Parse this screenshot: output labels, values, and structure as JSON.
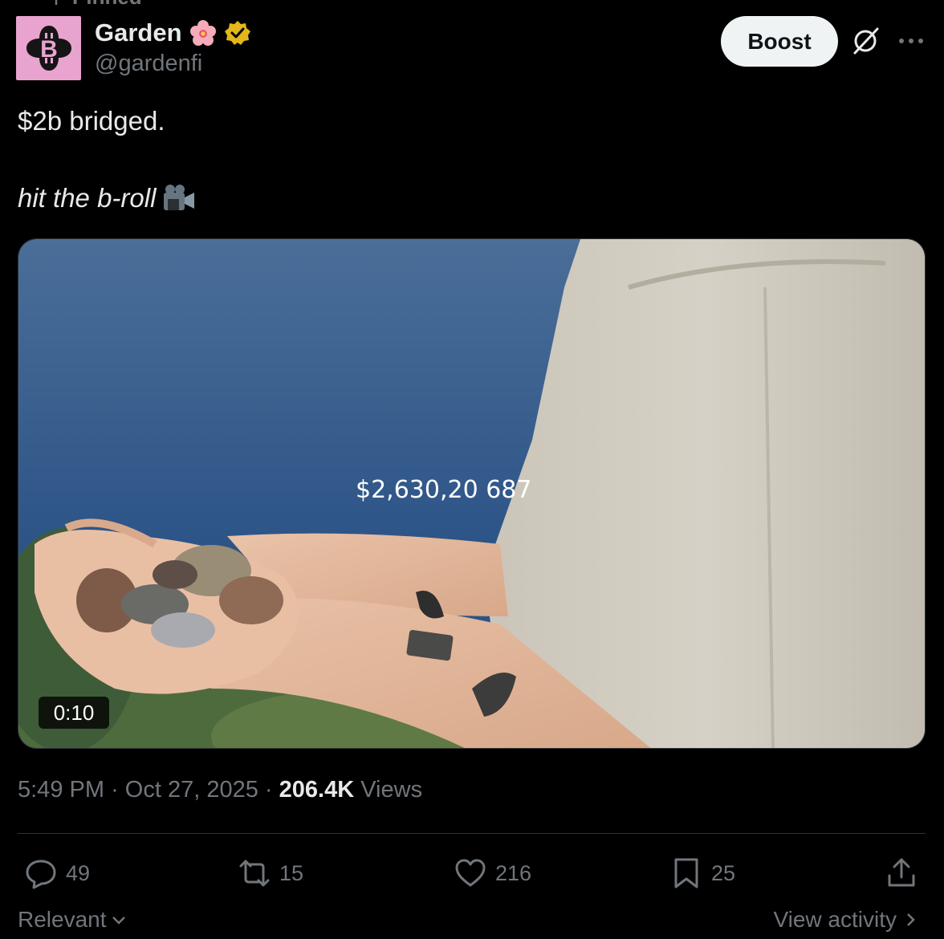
{
  "pinned_label": "Pinned",
  "author": {
    "display_name": "Garden",
    "handle": "@gardenfi"
  },
  "header": {
    "boost_label": "Boost"
  },
  "tweet": {
    "line1": "$2b bridged.",
    "line2": "hit the b-roll"
  },
  "media": {
    "duration": "0:10",
    "overlay_text": "$2,630,20 687"
  },
  "meta": {
    "time": "5:49 PM",
    "separator": "·",
    "date": "Oct 27, 2025",
    "views_count": "206.4K",
    "views_label": "Views"
  },
  "actions": {
    "replies": "49",
    "reposts": "15",
    "likes": "216",
    "bookmarks": "25"
  },
  "footer": {
    "sort_label": "Relevant",
    "activity_label": "View activity"
  },
  "colors": {
    "background": "#000000",
    "text": "#e7e9ea",
    "muted": "#71767b",
    "verified_gold": "#e2b719",
    "avatar_pink": "#e9a3cf"
  }
}
